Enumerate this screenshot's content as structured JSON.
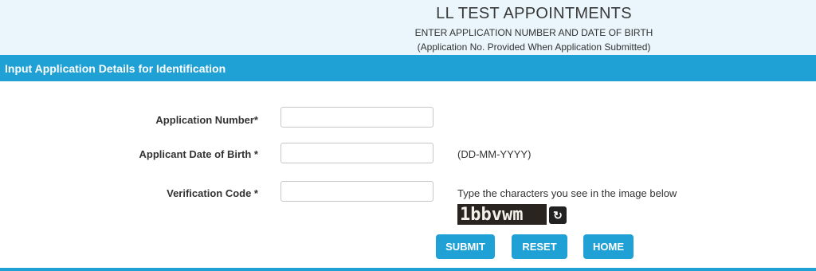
{
  "header": {
    "title": "LL TEST APPOINTMENTS",
    "subtitle": "ENTER APPLICATION NUMBER AND DATE OF BIRTH",
    "note": "(Application No. Provided When Application Submitted)"
  },
  "section": {
    "title": "Input Application Details for Identification"
  },
  "form": {
    "application_number": {
      "label": "Application Number*",
      "value": "",
      "placeholder": ""
    },
    "dob": {
      "label": "Applicant Date of Birth *",
      "value": "",
      "placeholder": "",
      "hint": "(DD-MM-YYYY)"
    },
    "verification": {
      "label": "Verification Code *",
      "value": "",
      "placeholder": "",
      "hint": "Type the characters you see in the image below"
    },
    "captcha_text": "1bbvwm",
    "refresh_icon": "refresh-icon"
  },
  "buttons": {
    "submit": "SUBMIT",
    "reset": "RESET",
    "home": "HOME"
  },
  "colors": {
    "accent": "#1fa1d6",
    "header_bg": "#eaf6fb"
  }
}
